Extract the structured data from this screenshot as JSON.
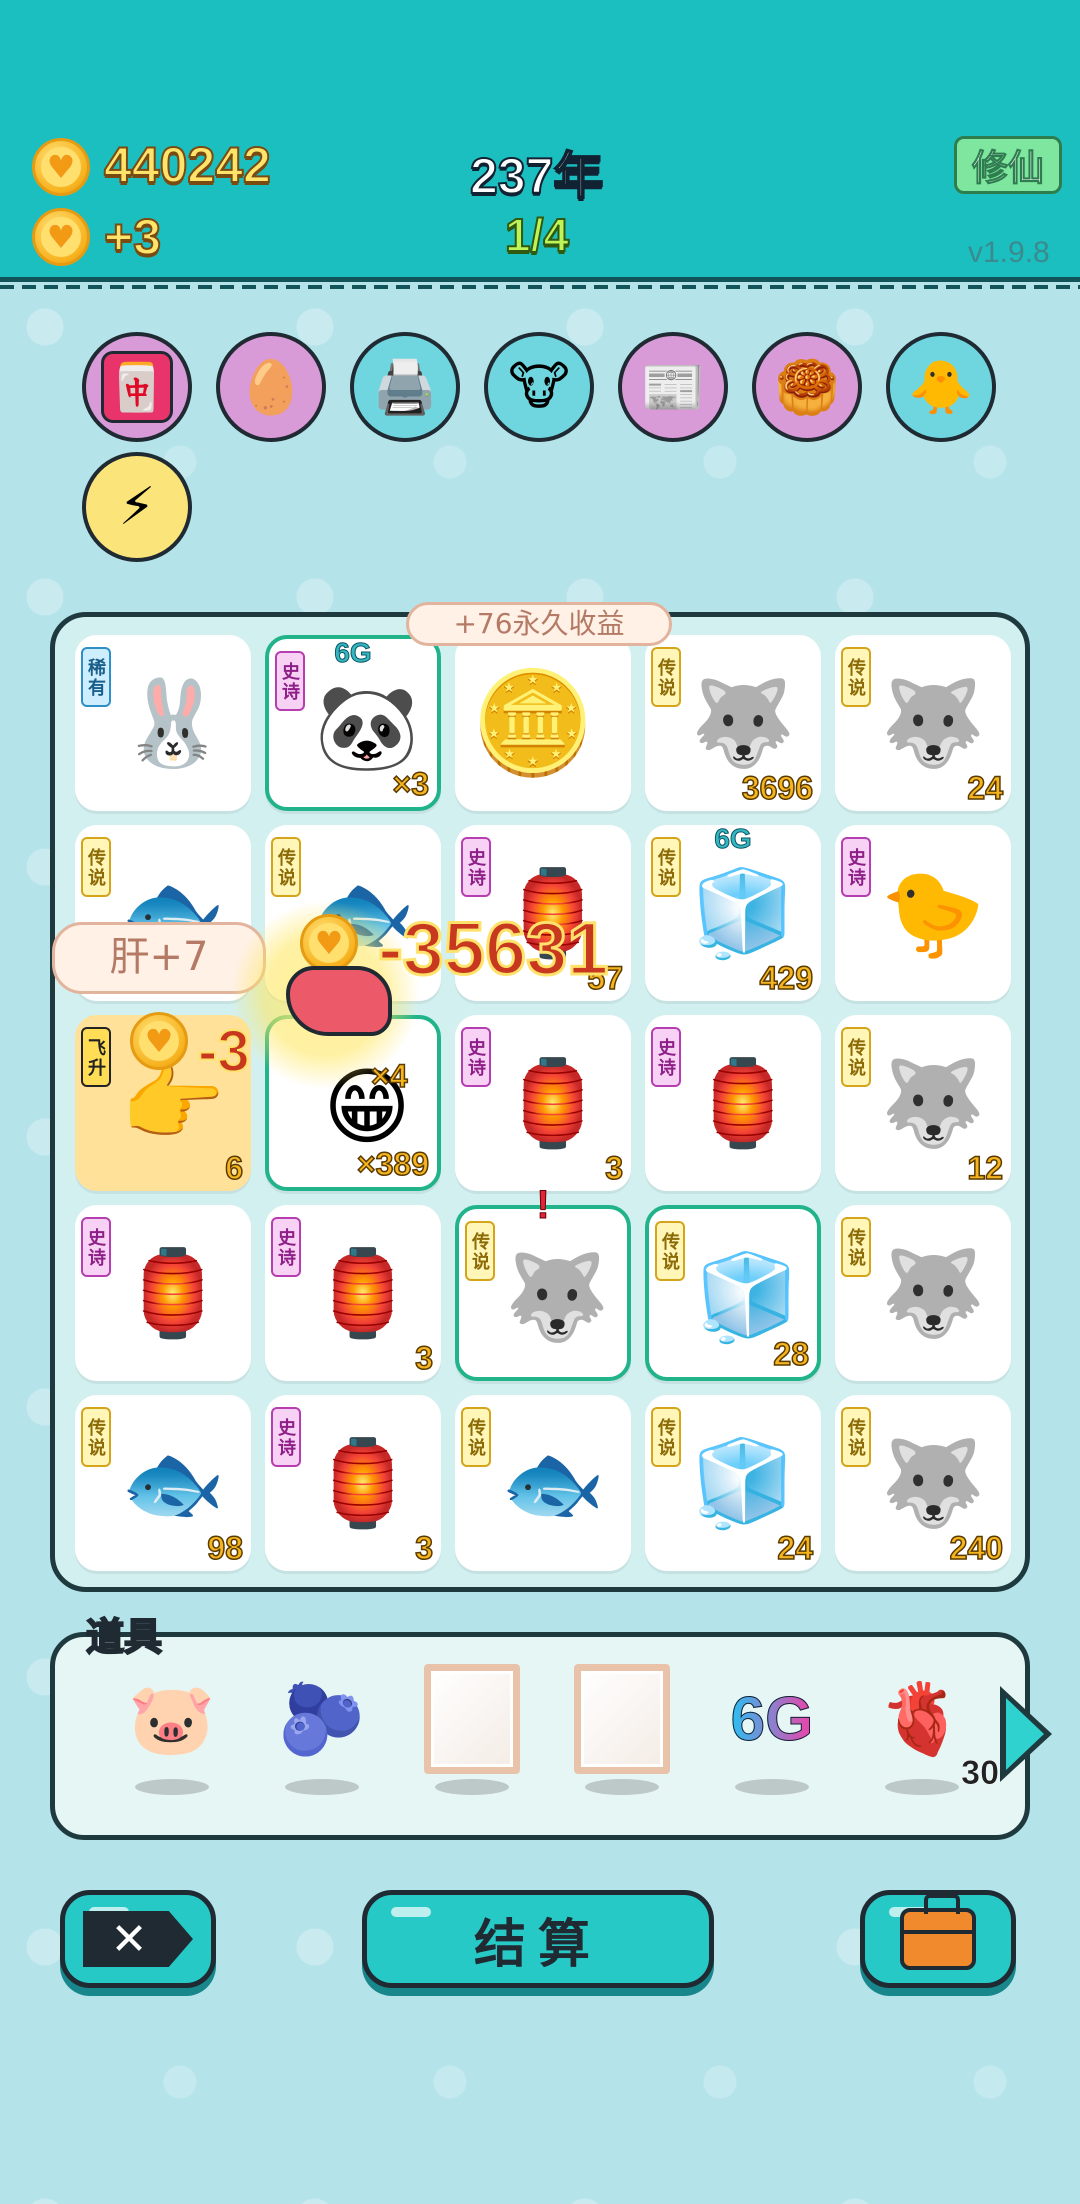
{
  "header": {
    "coins": "440242",
    "coin_rate": "+3",
    "year": "237年",
    "progress": "1/4",
    "xiuxian_label": "修仙",
    "version": "v1.9.8"
  },
  "skills": [
    {
      "name": "mahjong-skill",
      "icon": "🀄"
    },
    {
      "name": "egg-skill",
      "icon": "🥚"
    },
    {
      "name": "printer-skill",
      "icon": "🖨️"
    },
    {
      "name": "cows-skill",
      "icon": "🐮"
    },
    {
      "name": "time-magazine-skill",
      "icon": "📰"
    },
    {
      "name": "slingshot-skill",
      "icon": "🥮"
    },
    {
      "name": "chick-skill",
      "icon": "🐥"
    },
    {
      "name": "lightning-skill",
      "icon": "⚡"
    }
  ],
  "board": {
    "permanent_bubble": "+76永久收益",
    "liver_bubble": "肝+7",
    "float_damage": "-35631",
    "float_small": "-3",
    "cells": [
      {
        "tag": "稀有",
        "type": "rare",
        "icon": "🐰",
        "count": ""
      },
      {
        "tag": "史诗",
        "type": "epic",
        "icon": "🐼",
        "count": "×3",
        "top": "6G"
      },
      {
        "tag": "",
        "type": "",
        "icon": "🪙",
        "count": ""
      },
      {
        "tag": "传说",
        "type": "legend",
        "icon": "🐺",
        "count": "3696"
      },
      {
        "tag": "传说",
        "type": "legend",
        "icon": "🐺",
        "count": "24"
      },
      {
        "tag": "传说",
        "type": "legend",
        "icon": "🐟",
        "count": ""
      },
      {
        "tag": "传说",
        "type": "legend",
        "icon": "🐟",
        "count": ""
      },
      {
        "tag": "史诗",
        "type": "epic",
        "icon": "🏮",
        "count": "57"
      },
      {
        "tag": "传说",
        "type": "legend",
        "icon": "🧊",
        "count": "429",
        "top": "6G"
      },
      {
        "tag": "史诗",
        "type": "epic",
        "icon": "🐤",
        "count": ""
      },
      {
        "tag": "飞升",
        "type": "fly",
        "icon": "👉",
        "count": "6"
      },
      {
        "tag": "",
        "type": "",
        "icon": "😁",
        "count": "×389",
        "extra": "×4"
      },
      {
        "tag": "史诗",
        "type": "epic",
        "icon": "🏮",
        "count": "3"
      },
      {
        "tag": "史诗",
        "type": "epic",
        "icon": "🏮",
        "count": ""
      },
      {
        "tag": "传说",
        "type": "legend",
        "icon": "🐺",
        "count": "12"
      },
      {
        "tag": "史诗",
        "type": "epic",
        "icon": "🏮",
        "count": ""
      },
      {
        "tag": "史诗",
        "type": "epic",
        "icon": "🏮",
        "count": "3"
      },
      {
        "tag": "传说",
        "type": "legend",
        "icon": "🐺",
        "count": "",
        "alert": "!"
      },
      {
        "tag": "传说",
        "type": "legend",
        "icon": "🧊",
        "count": "28"
      },
      {
        "tag": "传说",
        "type": "legend",
        "icon": "🐺",
        "count": ""
      },
      {
        "tag": "传说",
        "type": "legend",
        "icon": "🐟",
        "count": "98"
      },
      {
        "tag": "史诗",
        "type": "epic",
        "icon": "🏮",
        "count": "3"
      },
      {
        "tag": "传说",
        "type": "legend",
        "icon": "🐟",
        "count": ""
      },
      {
        "tag": "传说",
        "type": "legend",
        "icon": "🧊",
        "count": "24"
      },
      {
        "tag": "传说",
        "type": "legend",
        "icon": "🐺",
        "count": "240"
      }
    ]
  },
  "items": {
    "title": "道具",
    "list": [
      {
        "name": "piggy-bank",
        "icon": "🐷"
      },
      {
        "name": "blueberry",
        "icon": "🫐"
      },
      {
        "name": "frame-1",
        "icon": "frame"
      },
      {
        "name": "frame-2",
        "icon": "frame"
      },
      {
        "name": "6g",
        "icon": "6G"
      },
      {
        "name": "liver",
        "icon": "🫀",
        "count": "30"
      }
    ]
  },
  "buttons": {
    "exit_label": "✕",
    "settle_label": "结算"
  }
}
